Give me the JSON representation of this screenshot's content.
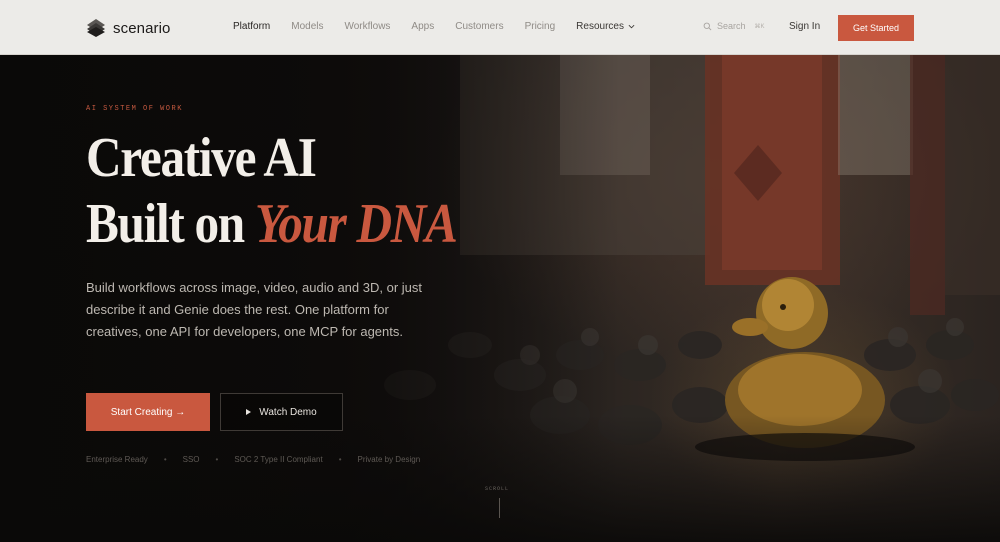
{
  "brand": {
    "name": "scenario",
    "logo_icon": "layered-diamond-icon"
  },
  "nav": {
    "links": [
      {
        "label": "Platform",
        "active": true
      },
      {
        "label": "Models",
        "active": false
      },
      {
        "label": "Workflows",
        "active": false
      },
      {
        "label": "Apps",
        "active": false
      },
      {
        "label": "Customers",
        "active": false
      },
      {
        "label": "Pricing",
        "active": false
      },
      {
        "label": "Resources",
        "active": false,
        "has_dropdown": true
      }
    ],
    "search": {
      "placeholder": "Search",
      "shortcut": "⌘K"
    },
    "signin_label": "Sign In",
    "cta_label": "Get Started"
  },
  "hero": {
    "eyebrow": "AI SYSTEM OF WORK",
    "title_line1": "Creative AI",
    "title_line2_plain": "Built on ",
    "title_line2_accent": "Your DNA",
    "description": "Build workflows across image, video, audio and 3D, or just describe it and Genie does the rest. One platform for creatives, one API for developers, one MCP for agents.",
    "primary_cta": "Start Creating →",
    "secondary_cta": "Watch Demo",
    "badges": [
      "Enterprise Ready",
      "SSO",
      "SOC 2 Type II Compliant",
      "Private by Design"
    ],
    "badge_separator": "•",
    "scroll_label": "SCROLL"
  },
  "colors": {
    "accent": "#c9583f",
    "nav_bg": "#ecebe8",
    "hero_bg": "#0e0c0b",
    "title": "#f3efe9"
  }
}
